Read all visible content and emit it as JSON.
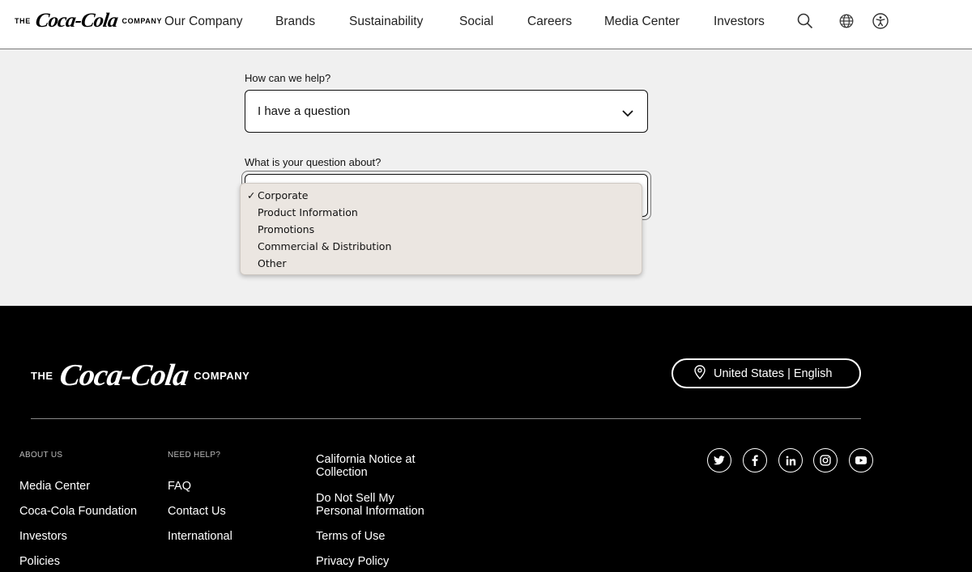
{
  "header": {
    "brand": {
      "prefix": "THE",
      "script": "Coca-Cola",
      "suffix": "COMPANY"
    },
    "nav": [
      {
        "label": "Our Company"
      },
      {
        "label": "Brands"
      },
      {
        "label": "Sustainability"
      },
      {
        "label": "Social"
      },
      {
        "label": "Careers"
      },
      {
        "label": "Media Center"
      },
      {
        "label": "Investors"
      }
    ],
    "icons": [
      "search-icon",
      "globe-icon",
      "accessibility-icon"
    ]
  },
  "form": {
    "help": {
      "label": "How can we help?",
      "value": "I have a question"
    },
    "topic": {
      "label": "What is your question about?",
      "options": [
        {
          "label": "Corporate",
          "selected": true
        },
        {
          "label": "Product Information",
          "selected": false
        },
        {
          "label": "Promotions",
          "selected": false
        },
        {
          "label": "Commercial & Distribution",
          "selected": false
        },
        {
          "label": "Other",
          "selected": false
        }
      ],
      "check_glyph": "✓"
    }
  },
  "footer": {
    "brand": {
      "prefix": "THE",
      "script": "Coca-Cola",
      "suffix": "COMPANY"
    },
    "region": {
      "label": "United States | English",
      "icon": "location-pin-icon"
    },
    "columns": {
      "about": {
        "title": "ABOUT US",
        "links": [
          {
            "label": "Media Center"
          },
          {
            "label": "Coca-Cola Foundation"
          },
          {
            "label": "Investors"
          },
          {
            "label": "Policies"
          }
        ]
      },
      "help": {
        "title": "NEED HELP?",
        "links": [
          {
            "label": "FAQ"
          },
          {
            "label": "Contact Us"
          },
          {
            "label": "International"
          }
        ]
      },
      "legal": {
        "links": [
          {
            "line1": "California Notice at",
            "line2": "Collection"
          },
          {
            "line1": "Do Not Sell My",
            "line2": "Personal Information"
          },
          {
            "line1": "Terms of Use"
          },
          {
            "line1": "Privacy Policy"
          }
        ]
      }
    },
    "social": [
      "twitter-icon",
      "facebook-icon",
      "linkedin-icon",
      "instagram-icon",
      "youtube-icon"
    ]
  }
}
